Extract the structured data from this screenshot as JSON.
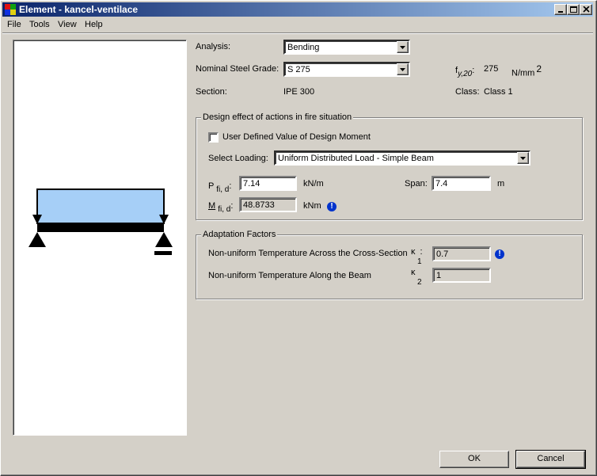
{
  "window": {
    "title": "Element - kancel-ventilace"
  },
  "menu": [
    "File",
    "Tools",
    "View",
    "Help"
  ],
  "analysis": {
    "label": "Analysis:",
    "value": "Bending"
  },
  "steel_grade": {
    "label": "Nominal Steel Grade:",
    "value": "S 275"
  },
  "fy": {
    "symbol": "f",
    "subscript": "y,20",
    "colon": ":",
    "value": "275",
    "unit": "N/mm",
    "unit_sup": "2"
  },
  "section": {
    "label": "Section:",
    "value": "IPE 300"
  },
  "class": {
    "label": "Class:",
    "value": "Class 1"
  },
  "design_group": {
    "title": "Design effect of actions in fire situation",
    "user_defined_label": "User Defined Value of Design Moment",
    "user_defined_checked": false,
    "loading_label": "Select Loading:",
    "loading_value": "Uniform Distributed Load - Simple Beam",
    "p_symbol": "P",
    "p_sub": "fi, d",
    "p_colon": ":",
    "p_value": "7.14",
    "p_unit": "kN/m",
    "span_label": "Span:",
    "span_value": "7.4",
    "span_unit": "m",
    "m_symbol": "M",
    "m_sub": "fi, d",
    "m_colon": ":",
    "m_value": "48.8733",
    "m_unit": "kNm"
  },
  "adaptation_group": {
    "title": "Adaptation Factors",
    "k1_label": "Non-uniform Temperature Across the Cross-Section",
    "k1_symbol": "κ",
    "k1_sub": "1",
    "k1_colon": ":",
    "k1_value": "0.7",
    "k2_label": "Non-uniform Temperature Along the Beam",
    "k2_symbol": "κ",
    "k2_sub": "2",
    "k2_value": "1"
  },
  "buttons": {
    "ok": "OK",
    "cancel": "Cancel"
  },
  "colors": {
    "beam_load_fill": "#a6cff7",
    "title_start": "#0a246a",
    "title_end": "#a6caf0",
    "info_icon": "#0033cc"
  },
  "icons": {
    "app": "app-palette-icon",
    "info": "info-icon",
    "dropdown": "chevron-down-icon"
  }
}
